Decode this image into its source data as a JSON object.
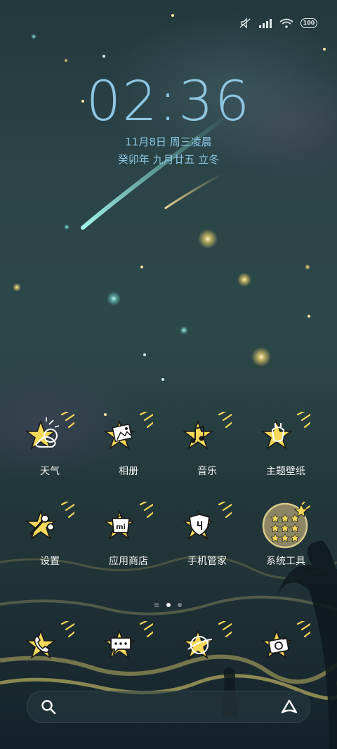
{
  "status_bar": {
    "battery": "100",
    "icons": [
      "mute-icon",
      "signal-icon",
      "wifi-icon",
      "battery-icon"
    ]
  },
  "lockscreen": {
    "time": "02:36",
    "date": "11月8日 周三凌晨",
    "lunar": "癸卯年 九月廿五 立冬"
  },
  "apps_row1": [
    {
      "label": "天气",
      "icon": "weather-icon"
    },
    {
      "label": "相册",
      "icon": "gallery-icon"
    },
    {
      "label": "音乐",
      "icon": "music-icon"
    },
    {
      "label": "主题壁纸",
      "icon": "themes-icon"
    }
  ],
  "apps_row2": [
    {
      "label": "设置",
      "icon": "settings-icon"
    },
    {
      "label": "应用商店",
      "icon": "app-store-icon"
    },
    {
      "label": "手机管家",
      "icon": "security-icon"
    },
    {
      "label": "系统工具",
      "icon": "tools-folder-icon"
    }
  ],
  "dock": [
    {
      "icon": "phone-icon"
    },
    {
      "icon": "messages-icon"
    },
    {
      "icon": "browser-icon"
    },
    {
      "icon": "camera-icon"
    }
  ],
  "page_indicator": {
    "pages": 3,
    "current": 2
  },
  "colors": {
    "clock": "#8ec5e0",
    "star": "#f3d85a",
    "label": "#f2f4f2"
  }
}
